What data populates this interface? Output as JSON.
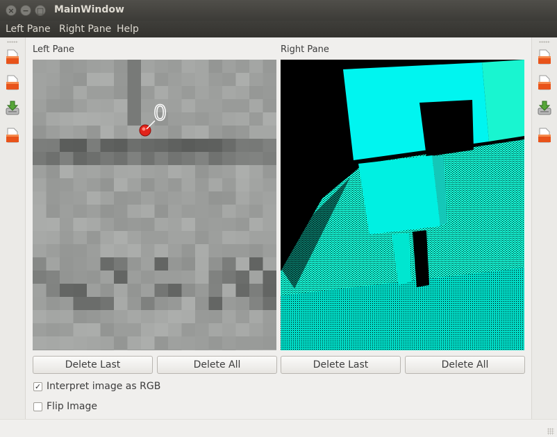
{
  "window": {
    "title": "MainWindow",
    "controls": {
      "close": "×",
      "minimize": "−",
      "maximize": "□"
    }
  },
  "menubar": {
    "items": [
      "Left Pane",
      "Right Pane",
      "Help"
    ]
  },
  "toolbars": {
    "left": [
      "open-file-icon",
      "open-file-icon",
      "save-download-icon",
      "open-file-icon"
    ],
    "right": [
      "open-file-icon",
      "open-file-icon",
      "save-download-icon",
      "open-file-icon"
    ]
  },
  "left_pane": {
    "label": "Left Pane",
    "image": "grayscale-closeup",
    "marker": {
      "id": "0",
      "color": "#e2231a"
    },
    "delete_last": "Delete Last",
    "delete_all": "Delete All"
  },
  "right_pane": {
    "label": "Right Pane",
    "image": "depth-map-point-cloud",
    "delete_last": "Delete Last",
    "delete_all": "Delete All"
  },
  "options": {
    "interpret_rgb": {
      "label": "Interpret image as RGB",
      "checked": true,
      "mark": "✓"
    },
    "flip_image": {
      "label": "Flip Image",
      "checked": false,
      "mark": ""
    }
  },
  "colors": {
    "depth_cyan": "#00ffe0",
    "depth_teal": "#00c8a8",
    "marker_red": "#e2231a"
  }
}
